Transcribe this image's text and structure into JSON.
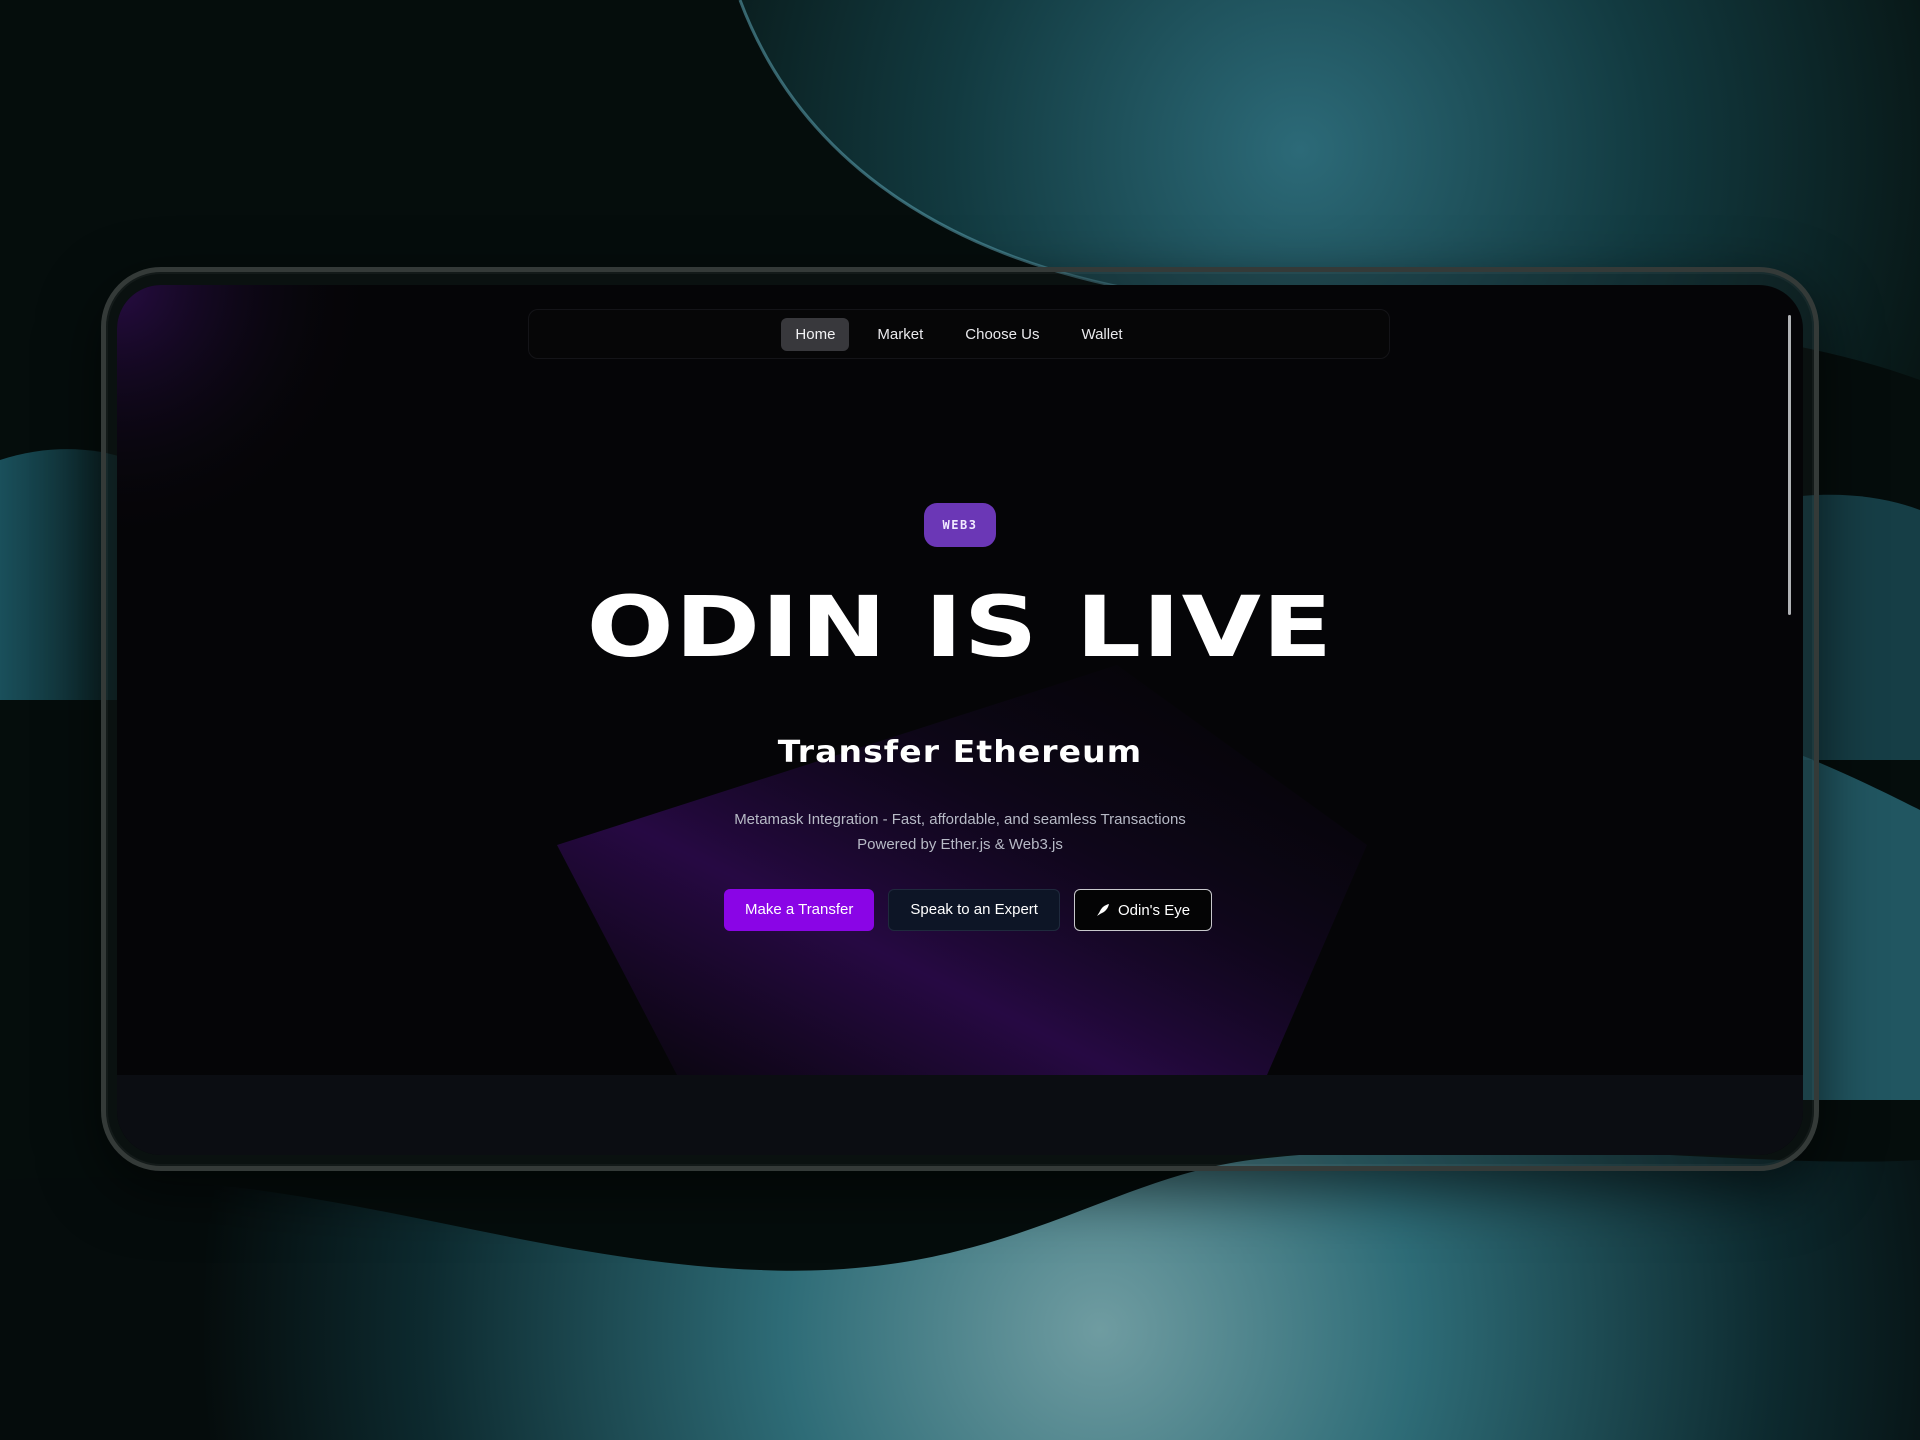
{
  "navigation": {
    "items": [
      {
        "label": "Home",
        "active": true
      },
      {
        "label": "Market",
        "active": false
      },
      {
        "label": "Choose Us",
        "active": false
      },
      {
        "label": "Wallet",
        "active": false
      }
    ]
  },
  "hero": {
    "badge": "WEB3",
    "headline": "ODIN IS LIVE",
    "subheadline": "Transfer Ethereum",
    "description_line1": "Metamask Integration - Fast, affordable, and seamless Transactions",
    "description_line2": "Powered by Ether.js & Web3.js"
  },
  "actions": {
    "primary": "Make a Transfer",
    "secondary": "Speak to an Expert",
    "tertiary": "Odin's Eye",
    "tertiary_icon": "rocket-icon"
  },
  "colors": {
    "accent": "#8a05e6",
    "badge": "#6b37b6",
    "background": "#050507",
    "secondary_button": "#0d1526"
  }
}
